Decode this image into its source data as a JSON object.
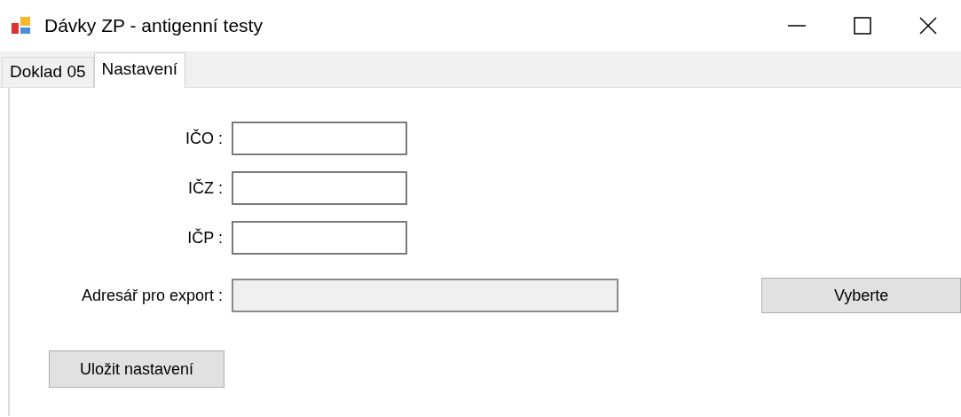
{
  "window": {
    "title": "Dávky ZP - antigenní testy"
  },
  "tabs": [
    {
      "label": "Doklad 05",
      "selected": false
    },
    {
      "label": "Nastavení",
      "selected": true
    }
  ],
  "fields": [
    {
      "label": "IČO :",
      "readonly": false
    },
    {
      "label": "IČZ :",
      "readonly": false
    },
    {
      "label": "IČP :",
      "readonly": false
    }
  ],
  "export": {
    "label": "Adresář pro export :",
    "readonly": true,
    "button": "Vyberte"
  },
  "save_button": "Uložit nastavení"
}
